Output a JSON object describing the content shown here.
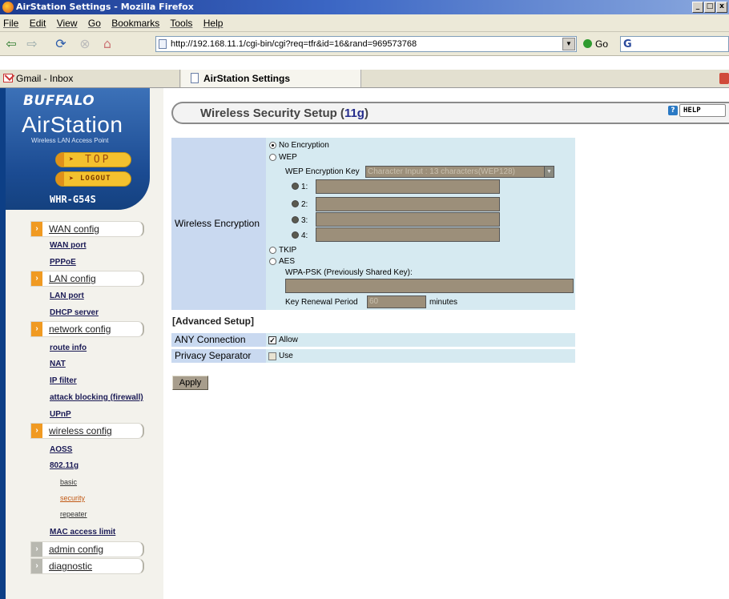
{
  "window": {
    "title": "AirStation Settings - Mozilla Firefox",
    "controls": [
      "_",
      "□",
      "x"
    ]
  },
  "menu": [
    "File",
    "Edit",
    "View",
    "Go",
    "Bookmarks",
    "Tools",
    "Help"
  ],
  "navbar": {
    "url": "http://192.168.11.1/cgi-bin/cgi?req=tfr&id=16&rand=969573768",
    "go_label": "Go",
    "search_glyph": "G"
  },
  "tabs": [
    {
      "label": "Gmail - Inbox"
    },
    {
      "label": "AirStation Settings"
    }
  ],
  "sidebar": {
    "brand": "BUFFALO",
    "product": "AirStation",
    "subtitle": "Wireless LAN Access Point",
    "top_label": "TOP",
    "logout_label": "LOGOUT",
    "model": "WHR-G54S",
    "categories": {
      "wan": "WAN config",
      "lan": "LAN config",
      "network": "network config",
      "wireless": "wireless config",
      "admin": "admin config",
      "diagnostic": "diagnostic"
    },
    "links": {
      "wan_port": "WAN port",
      "pppoe": "PPPoE",
      "lan_port": "LAN port",
      "dhcp": "DHCP server",
      "route_info": "route info",
      "nat": "NAT",
      "ip_filter": "IP filter",
      "attack": "attack blocking (firewall)",
      "upnp": "UPnP",
      "aoss": "AOSS",
      "dot11g": "802.11g",
      "basic": "basic",
      "security": "security",
      "repeater": "repeater",
      "mac_limit": "MAC access limit"
    }
  },
  "main": {
    "heading_prefix": "Wireless Security Setup (",
    "heading_std": "11g",
    "heading_suffix": ")",
    "help_label": "HELP",
    "encryption": {
      "label": "Wireless Encryption",
      "opt_none": "No Encryption",
      "opt_wep": "WEP",
      "wep_key_label": "WEP Encryption Key",
      "wep_key_select": "Character Input : 13 characters(WEP128)",
      "keys": [
        "1:",
        "2:",
        "3:",
        "4:"
      ],
      "opt_tkip": "TKIP",
      "opt_aes": "AES",
      "psk_label": "WPA-PSK (Previously Shared Key):",
      "renewal_label": "Key Renewal Period",
      "renewal_value": "60",
      "renewal_unit": "minutes",
      "selected": "No Encryption"
    },
    "advanced": {
      "title": "[Advanced Setup]",
      "any_label": "ANY Connection",
      "any_value": "Allow",
      "any_checked": true,
      "privacy_label": "Privacy Separator",
      "privacy_value": "Use",
      "privacy_checked": false
    },
    "apply_label": "Apply"
  }
}
